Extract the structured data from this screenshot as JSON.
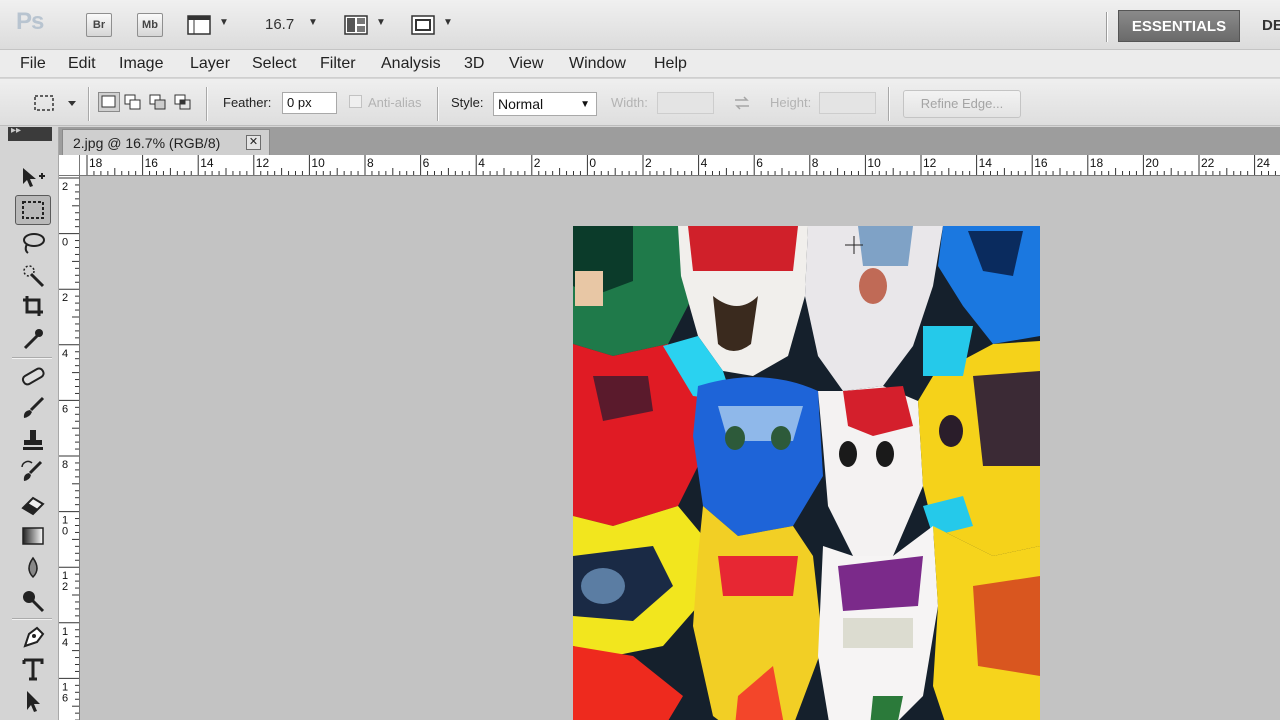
{
  "app_bar": {
    "logo": "Ps",
    "bridge_label": "Br",
    "minibridge_label": "Mb",
    "zoom_value": "16.7",
    "workspace_active": "ESSENTIALS",
    "workspace_next": "DE"
  },
  "menu": [
    "File",
    "Edit",
    "Image",
    "Layer",
    "Select",
    "Filter",
    "Analysis",
    "3D",
    "View",
    "Window",
    "Help"
  ],
  "options": {
    "feather_label": "Feather:",
    "feather_value": "0 px",
    "antialias_label": "Anti-alias",
    "style_label": "Style:",
    "style_value": "Normal",
    "width_label": "Width:",
    "height_label": "Height:",
    "refine_edge_label": "Refine Edge..."
  },
  "document": {
    "tab_title": "2.jpg @ 16.7% (RGB/8)",
    "close_glyph": "✕"
  },
  "rulers": {
    "top_labels": [
      "18",
      "16",
      "14",
      "12",
      "10",
      "8",
      "6",
      "4",
      "2",
      "0",
      "2",
      "4",
      "6",
      "8",
      "10",
      "12",
      "14",
      "16",
      "18",
      "20",
      "22",
      "24"
    ],
    "left_labels": [
      "2",
      "0",
      "2",
      "4",
      "6",
      "8",
      "10",
      "12",
      "14",
      "16"
    ]
  },
  "tools": [
    "move-tool-icon",
    "rectangular-marquee-tool-icon",
    "lasso-tool-icon",
    "quick-selection-tool-icon",
    "crop-tool-icon",
    "eyedropper-tool-icon",
    "spot-healing-brush-icon",
    "brush-tool-icon",
    "clone-stamp-tool-icon",
    "history-brush-icon",
    "eraser-tool-icon",
    "gradient-tool-icon",
    "blur-tool-icon",
    "dodge-tool-icon",
    "pen-tool-icon",
    "type-tool-icon",
    "path-selection-tool-icon"
  ],
  "photo": {
    "subject": "lucha-libre-masks"
  },
  "colors": {
    "workspace_bg": "#c3c3c3",
    "accent_dark": "#6a6a6a"
  }
}
